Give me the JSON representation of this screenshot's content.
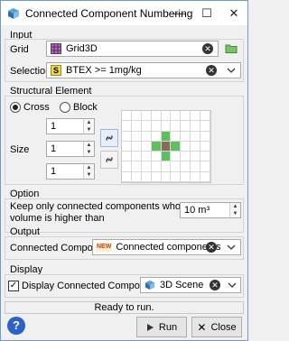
{
  "window": {
    "title": "Connected Component Numbering",
    "minimize": "—",
    "maximize": "☐",
    "close": "✕"
  },
  "input": {
    "group": "Input",
    "grid_label": "Grid",
    "grid_value": "Grid3D",
    "selection_label": "Selection",
    "selection_value": "BTEX >= 1mg/kg"
  },
  "structural": {
    "group": "Structural Element",
    "shape_options": [
      "Cross",
      "Block"
    ],
    "shape_selected": "Cross",
    "size_label": "Size",
    "sizes": [
      "1",
      "1",
      "1"
    ]
  },
  "option": {
    "group": "Option",
    "text_line1": "Keep only connected components whose",
    "text_line2": "volume is higher than",
    "volume_value": "10 m³"
  },
  "output": {
    "group": "Output",
    "label": "Connected Components",
    "badge": "NEW",
    "value": "Connected components"
  },
  "display": {
    "group": "Display",
    "checkbox_label": "Display Connected Components in",
    "checked": true,
    "scene_value": "3D Scene"
  },
  "status": "Ready to run.",
  "buttons": {
    "help": "?",
    "run": "Run",
    "close": "Close"
  },
  "colors": {
    "accent": "#2b62c7",
    "kernel_green": "#5fbf5f",
    "kernel_center": "#8a6a58"
  }
}
